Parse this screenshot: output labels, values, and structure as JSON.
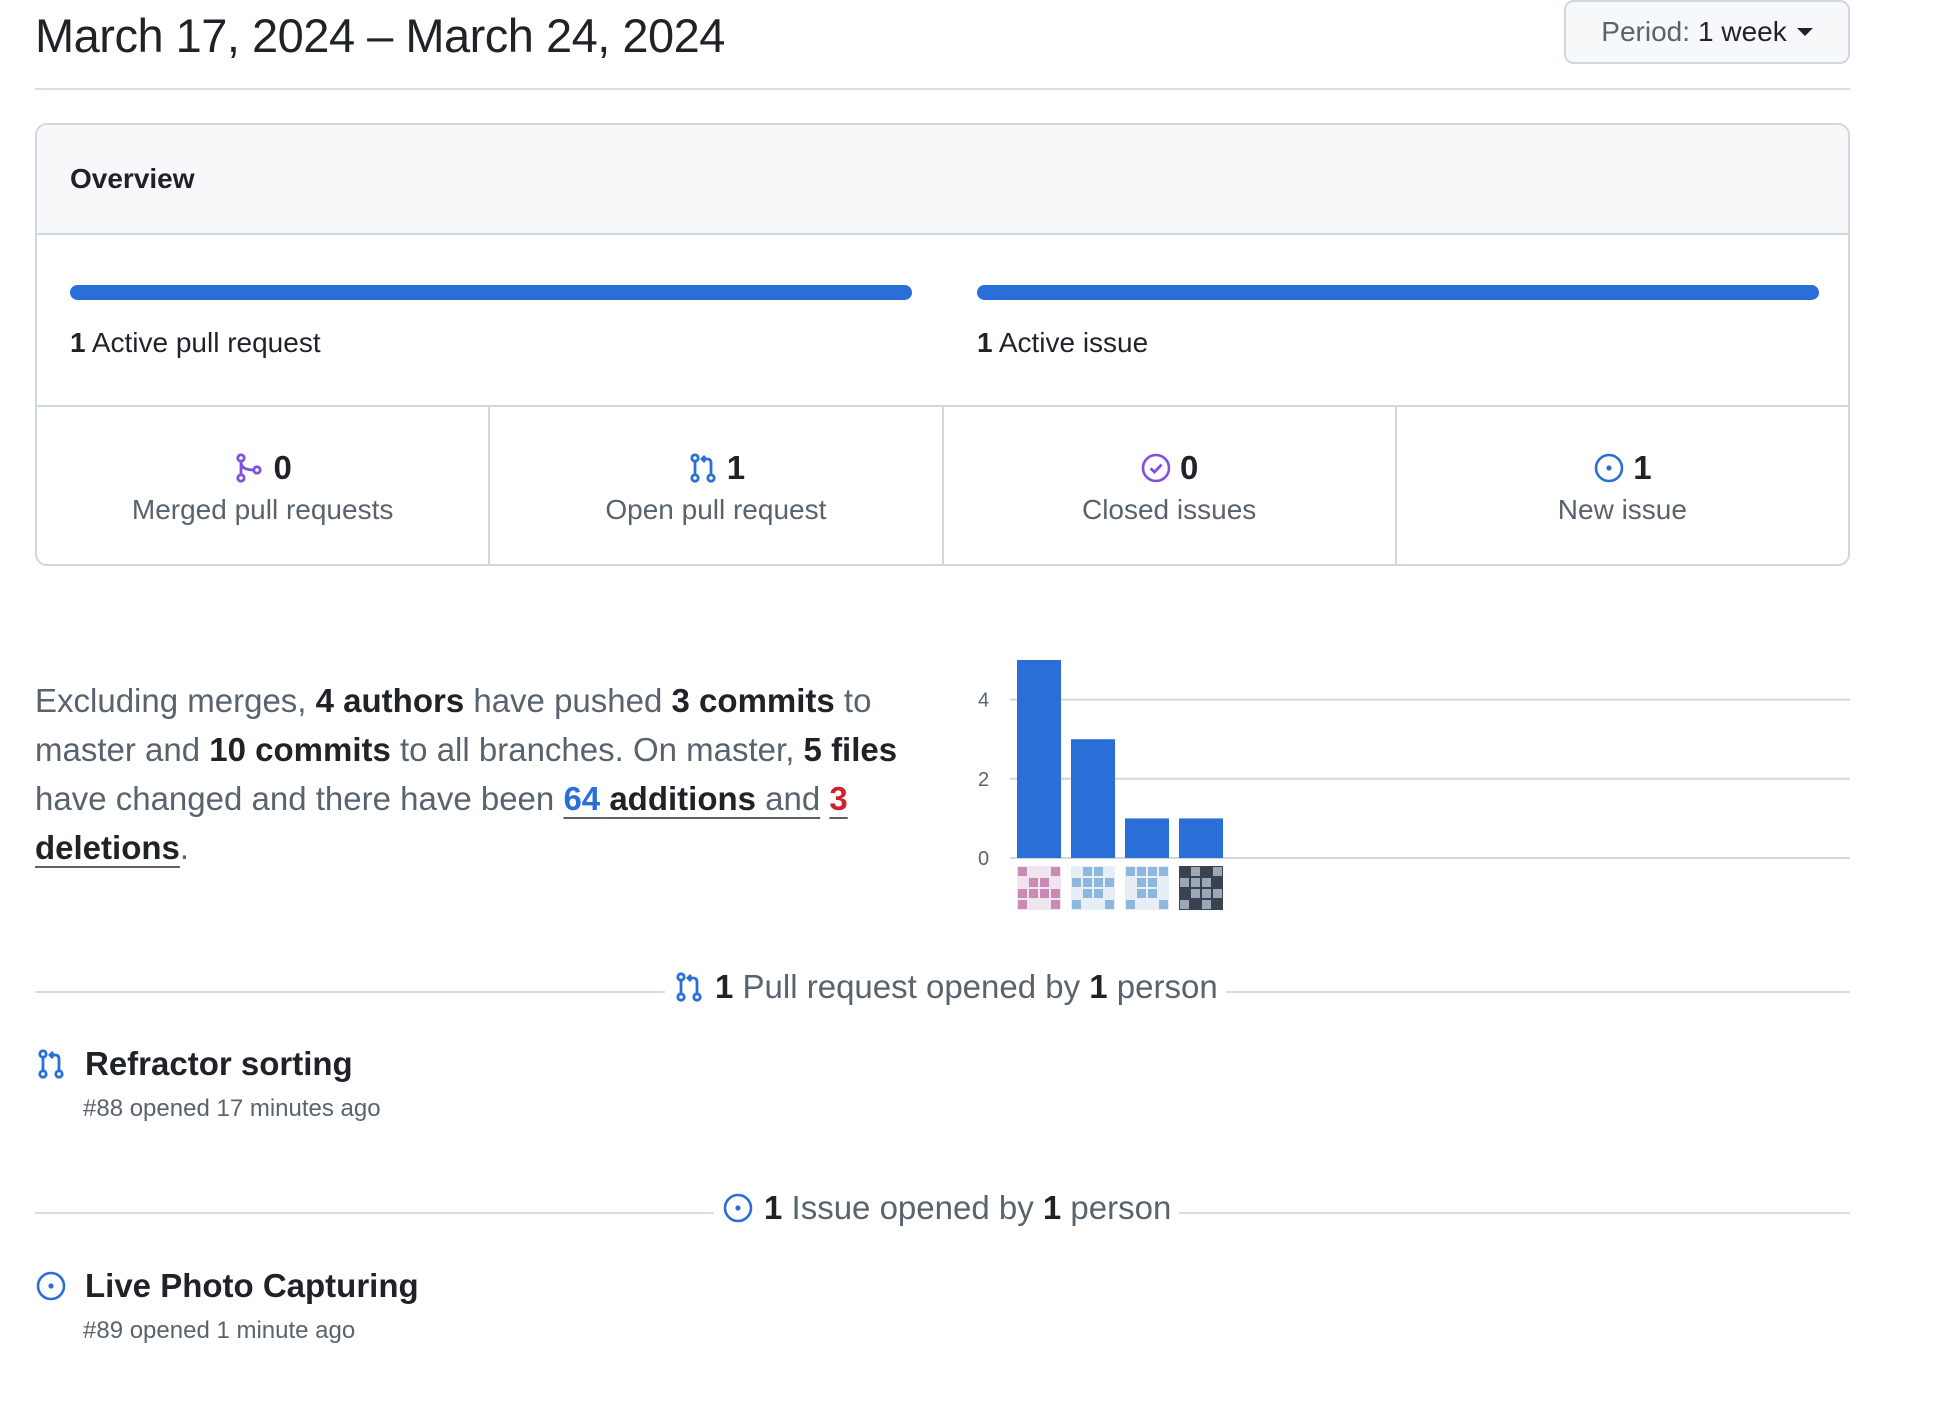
{
  "header": {
    "date_range": "March 17, 2024 – March 24, 2024",
    "period_label": "Period:",
    "period_value": "1 week"
  },
  "overview": {
    "title": "Overview",
    "active_pull_requests": {
      "count": "1",
      "label": "Active pull request",
      "progress": 1.0
    },
    "active_issues": {
      "count": "1",
      "label": "Active issue",
      "progress": 1.0
    },
    "stats": [
      {
        "icon": "merge-icon",
        "count": "0",
        "label": "Merged pull requests",
        "color": "#8250df"
      },
      {
        "icon": "pull-request-icon",
        "count": "1",
        "label": "Open pull request",
        "color": "#2a6fd8"
      },
      {
        "icon": "issue-closed-icon",
        "count": "0",
        "label": "Closed issues",
        "color": "#8250df"
      },
      {
        "icon": "issue-opened-icon",
        "count": "1",
        "label": "New issue",
        "color": "#2a6fd8"
      }
    ]
  },
  "summary": {
    "p1": "Excluding merges, ",
    "authors": "4 authors",
    "p2": " have pushed ",
    "commits_master": "3 commits",
    "p3": " to master and ",
    "commits_all": "10 commits",
    "p4": " to all branches. On master, ",
    "files": "5 files",
    "p5": " have changed and there have been ",
    "additions_num": "64",
    "additions_word": " additions",
    "p6": " and",
    "deletions_num": "3",
    "deletions_word": " deletions",
    "p7": "."
  },
  "chart_data": {
    "type": "bar",
    "categories": [
      "author-1",
      "author-2",
      "author-3",
      "author-4"
    ],
    "values": [
      5,
      3,
      1,
      1
    ],
    "yticks": [
      "0",
      "2",
      "4"
    ],
    "ylim": [
      0,
      5
    ],
    "bar_color": "#2a6fd8",
    "grid": true
  },
  "pull_requests_section": {
    "count": "1",
    "text1": " Pull request opened by ",
    "people": "1",
    "text2": " person",
    "items": [
      {
        "title": "Refractor sorting",
        "meta": "#88 opened 17 minutes ago"
      }
    ]
  },
  "issues_section": {
    "count": "1",
    "text1": " Issue opened by ",
    "people": "1",
    "text2": " person",
    "items": [
      {
        "title": "Live Photo Capturing",
        "meta": "#89 opened 1 minute ago"
      }
    ]
  }
}
